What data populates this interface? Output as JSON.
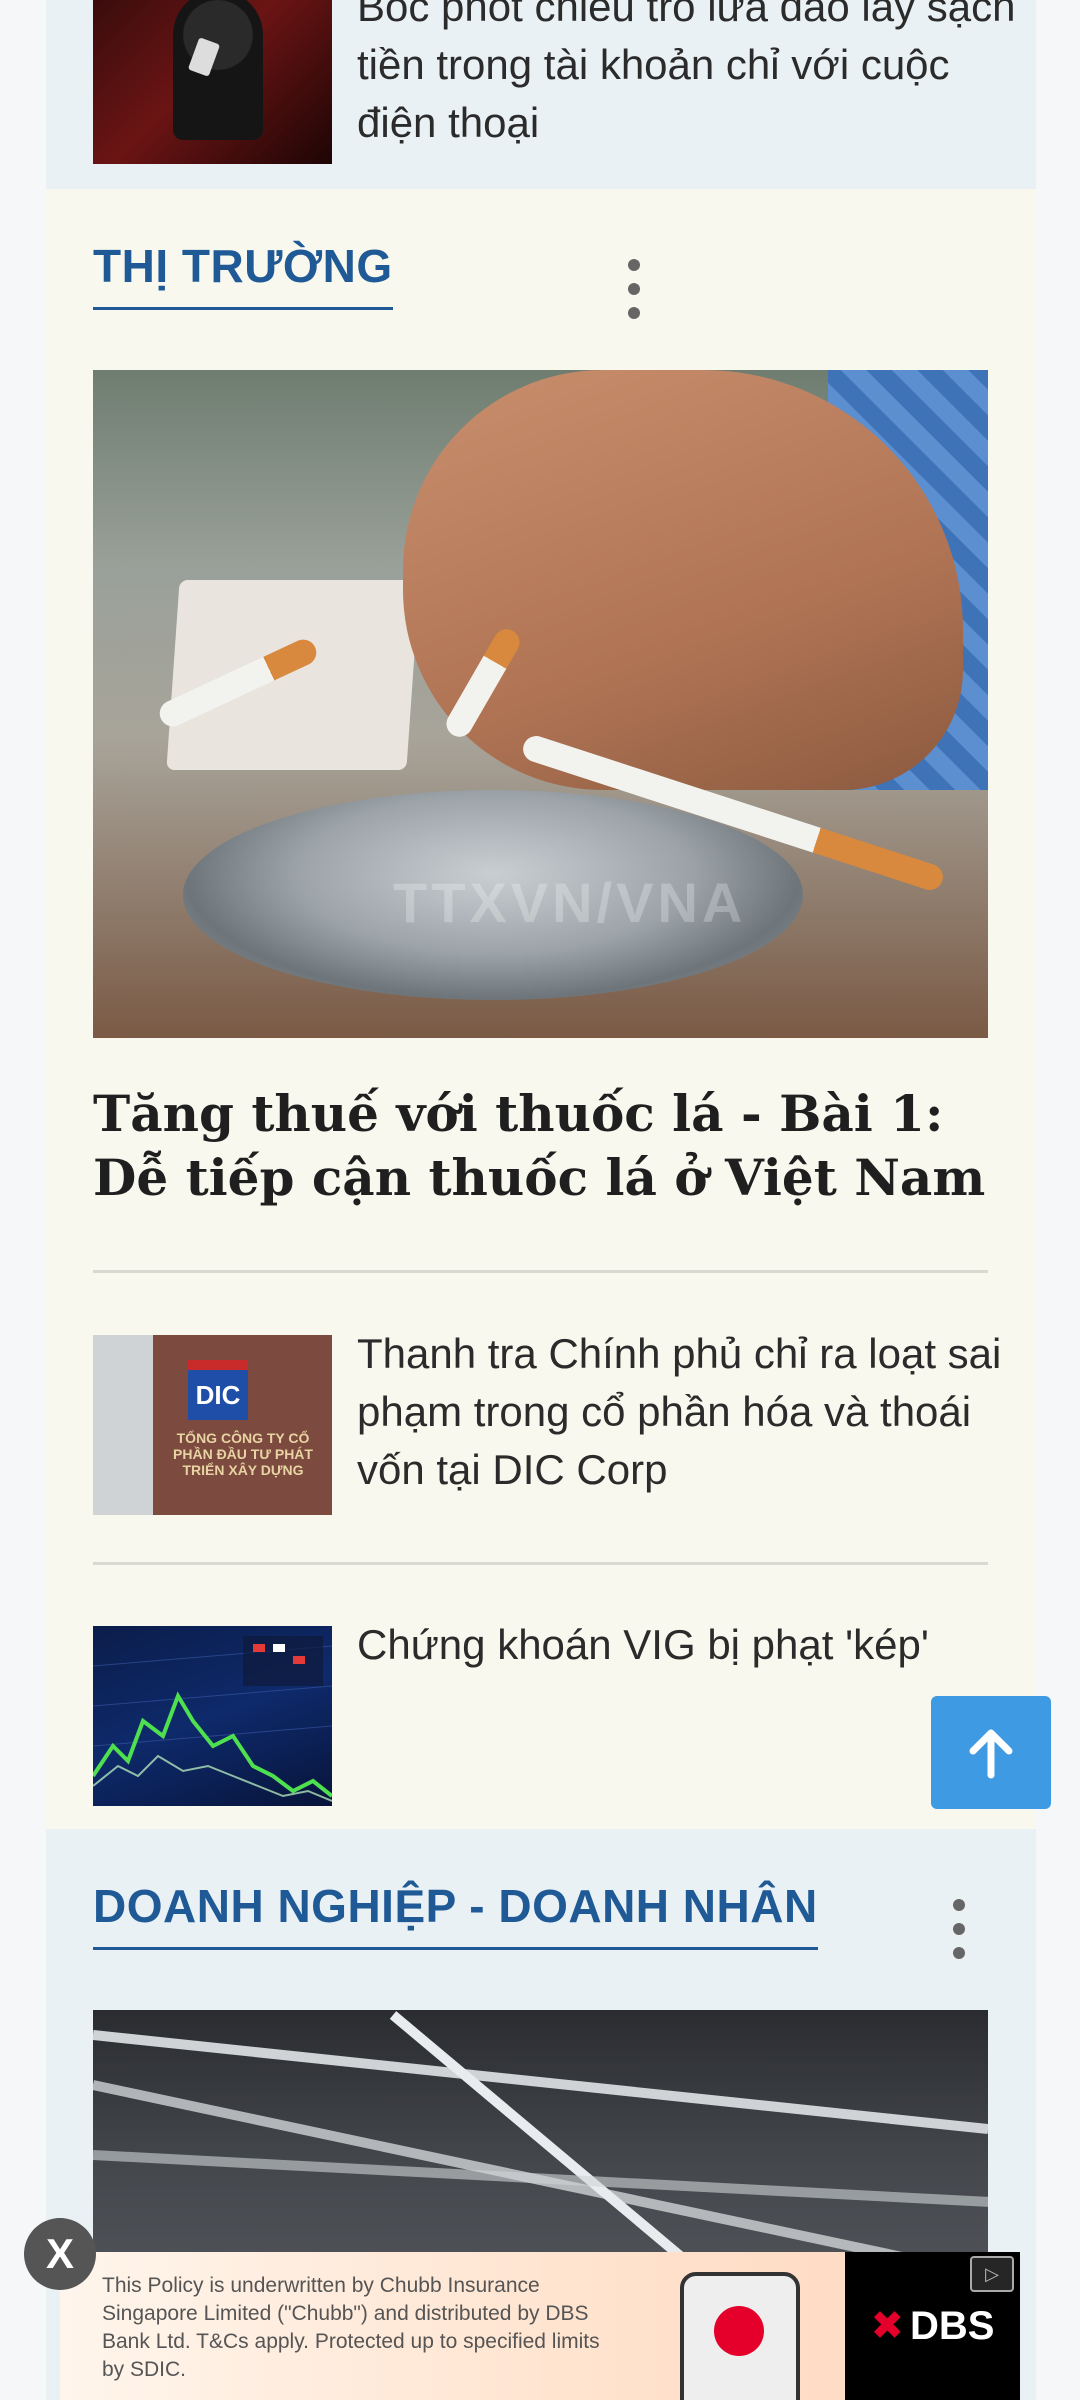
{
  "top_article": {
    "title": "Bóc phốt chiêu trò lừa đảo lấy sạch tiền trong tài khoản chỉ với cuộc điện thoại"
  },
  "market_section": {
    "heading": "THỊ TRƯỜNG",
    "menu_icon": "kebab-menu-icon",
    "hero": {
      "image_watermark": "TTXVN/VNA",
      "title": "Tăng thuế với thuốc lá - Bài 1: Dễ tiếp cận thuốc lá ở Việt Nam"
    },
    "items": [
      {
        "title": "Thanh tra Chính phủ chỉ ra loạt sai phạm trong cổ phần hóa và thoái vốn tại DIC Corp",
        "thumb_logo": "DIC",
        "thumb_sign": "TỔNG CÔNG TY CỔ PHẦN ĐẦU TƯ PHÁT TRIỂN XÂY DỰNG"
      },
      {
        "title": "Chứng khoán VIG bị phạt 'kép'"
      }
    ]
  },
  "business_section": {
    "heading": "DOANH NGHIỆP - DOANH NHÂN",
    "menu_icon": "kebab-menu-icon"
  },
  "back_to_top": {
    "icon": "arrow-up-icon"
  },
  "ad": {
    "close_label": "X",
    "text": "This Policy is underwritten by Chubb Insurance Singapore Limited (\"Chubb\") and distributed by DBS Bank Ltd. T&Cs apply. Protected up to specified limits by SDIC.",
    "brand": "DBS",
    "brand_mark": "✖",
    "adchoices_icon": "adchoices-icon"
  },
  "colors": {
    "section_heading": "#1f5a96",
    "back_to_top": "#3d9ae3",
    "market_bg": "#f8f8ee",
    "business_bg": "#e9f1f4"
  }
}
